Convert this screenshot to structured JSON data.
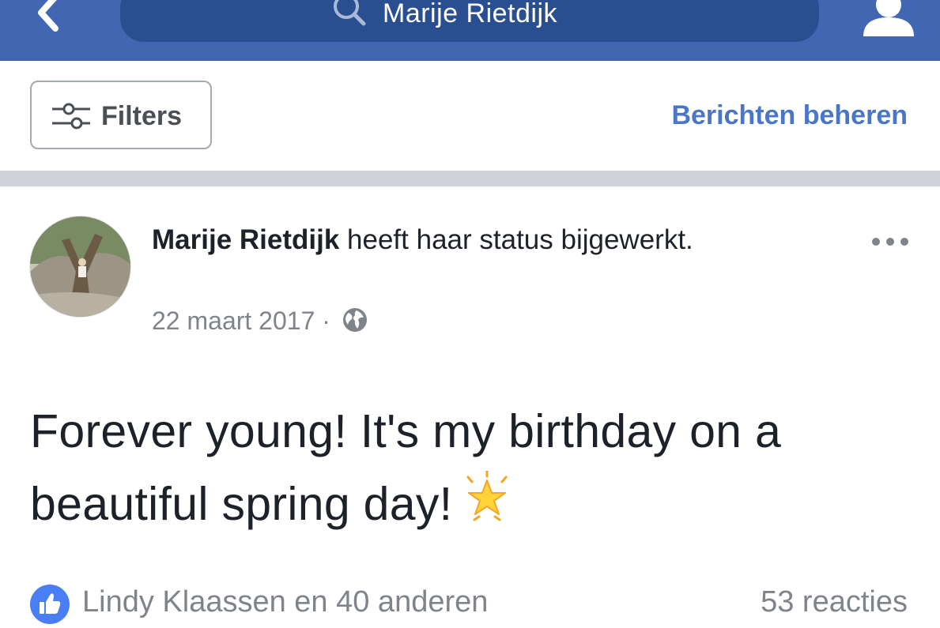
{
  "header": {
    "search_text": "Marije Rietdijk",
    "icons": [
      "back-chevron-icon",
      "search-icon",
      "profile-icon"
    ]
  },
  "filter_bar": {
    "filters_label": "Filters",
    "manage_posts_label": "Berichten beheren"
  },
  "post": {
    "author": "Marije Rietdijk",
    "action_text": "heeft haar status bijgewerkt.",
    "date": "22 maart 2017",
    "separator": "·",
    "privacy_icon": "globe-icon",
    "text": "Forever young! It's my birthday on a beautiful spring day!",
    "emoji": "glowing-star",
    "likes_text": "Lindy Klaassen en 40 anderen",
    "comments_text": "53 reacties"
  },
  "colors": {
    "nav_blue": "#4267b2",
    "search_field": "#294f91",
    "link_blue": "#4a76c7",
    "like_blue": "#4a7ef5",
    "text_dark": "#1d2129",
    "text_gray": "#7f838a",
    "divider_gray": "#cfd2d7"
  }
}
